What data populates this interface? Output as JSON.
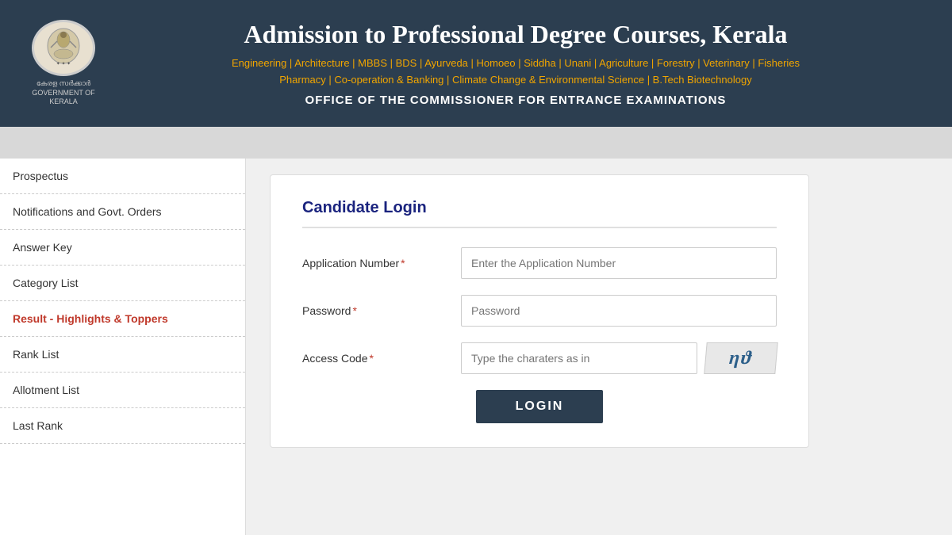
{
  "header": {
    "title": "Admission to Professional Degree Courses, Kerala",
    "courses_line1": "Engineering | Architecture | MBBS | BDS | Ayurveda | Homoeo | Siddha | Unani | Agriculture | Forestry | Veterinary | Fisheries",
    "courses_line2": "Pharmacy | Co-operation & Banking | Climate Change & Environmental Science | B.Tech Biotechnology",
    "office": "OFFICE OF THE COMMISSIONER FOR ENTRANCE EXAMINATIONS",
    "logo_text_line1": "കേരള സർക്കാർ",
    "logo_text_line2": "GOVERNMENT OF KERALA"
  },
  "sidebar": {
    "items": [
      {
        "label": "Prospectus",
        "highlight": false
      },
      {
        "label": "Notifications and Govt. Orders",
        "highlight": false
      },
      {
        "label": "Answer Key",
        "highlight": false
      },
      {
        "label": "Category List",
        "highlight": false
      },
      {
        "label": "Result - Highlights & Toppers",
        "highlight": true
      },
      {
        "label": "Rank List",
        "highlight": false
      },
      {
        "label": "Allotment List",
        "highlight": false
      },
      {
        "label": "Last Rank",
        "highlight": false
      }
    ]
  },
  "login": {
    "title": "Candidate Login",
    "app_number_label": "Application Number",
    "app_number_placeholder": "Enter the Application Number",
    "password_label": "Password",
    "password_placeholder": "Password",
    "access_code_label": "Access Code",
    "access_code_placeholder": "Type the charaters as in",
    "captcha_text": "ηϑ",
    "login_button": "LOGIN",
    "required_marker": "*"
  }
}
